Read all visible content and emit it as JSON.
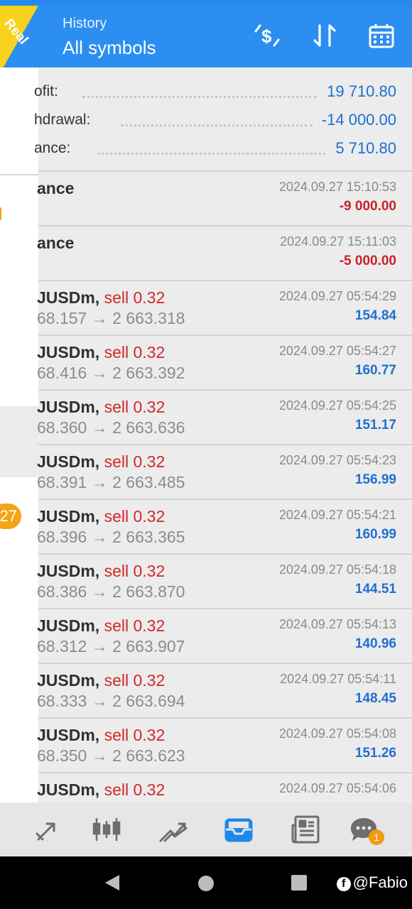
{
  "header": {
    "subtitle": "History",
    "title": "All symbols",
    "account_badge": "Real",
    "accent_color": "#2b8ef0"
  },
  "drawer": {
    "badge": "27"
  },
  "summary": {
    "rows": [
      {
        "label": "ofit:",
        "value": "19 710.80"
      },
      {
        "label": "hdrawal:",
        "value": "-14 000.00"
      },
      {
        "label": "ance:",
        "value": "5 710.80"
      }
    ]
  },
  "history": [
    {
      "title": "ance",
      "time": "2024.09.27 15:10:53",
      "value": "-9 000.00",
      "sign": "neg"
    },
    {
      "title": "ance",
      "time": "2024.09.27 15:11:03",
      "value": "-5 000.00",
      "sign": "neg"
    },
    {
      "symbol": "JUSDm,",
      "side": "sell 0.32",
      "prices": "68.157 → 2 663.318",
      "time": "2024.09.27 05:54:29",
      "value": "154.84",
      "sign": "pos"
    },
    {
      "symbol": "JUSDm,",
      "side": "sell 0.32",
      "prices": "68.416 → 2 663.392",
      "time": "2024.09.27 05:54:27",
      "value": "160.77",
      "sign": "pos"
    },
    {
      "symbol": "JUSDm,",
      "side": "sell 0.32",
      "prices": "68.360 → 2 663.636",
      "time": "2024.09.27 05:54:25",
      "value": "151.17",
      "sign": "pos"
    },
    {
      "symbol": "JUSDm,",
      "side": "sell 0.32",
      "prices": "68.391 → 2 663.485",
      "time": "2024.09.27 05:54:23",
      "value": "156.99",
      "sign": "pos"
    },
    {
      "symbol": "JUSDm,",
      "side": "sell 0.32",
      "prices": "68.396 → 2 663.365",
      "time": "2024.09.27 05:54:21",
      "value": "160.99",
      "sign": "pos"
    },
    {
      "symbol": "JUSDm,",
      "side": "sell 0.32",
      "prices": "68.386 → 2 663.870",
      "time": "2024.09.27 05:54:18",
      "value": "144.51",
      "sign": "pos"
    },
    {
      "symbol": "JUSDm,",
      "side": "sell 0.32",
      "prices": "68.312 → 2 663.907",
      "time": "2024.09.27 05:54:13",
      "value": "140.96",
      "sign": "pos"
    },
    {
      "symbol": "JUSDm,",
      "side": "sell 0.32",
      "prices": "68.333 → 2 663.694",
      "time": "2024.09.27 05:54:11",
      "value": "148.45",
      "sign": "pos"
    },
    {
      "symbol": "JUSDm,",
      "side": "sell 0.32",
      "prices": "68.350 → 2 663.623",
      "time": "2024.09.27 05:54:08",
      "value": "151.26",
      "sign": "pos"
    },
    {
      "symbol": "JUSDm,",
      "side": "sell 0.32",
      "prices": "",
      "time": "2024.09.27 05:54:06",
      "value": "",
      "sign": "pos"
    }
  ],
  "toolbar_icons": [
    "currency-exchange-icon",
    "sort-icon",
    "calendar-icon"
  ],
  "tabs": [
    {
      "icon": "quotes-icon",
      "active": false
    },
    {
      "icon": "chart-icon",
      "active": false
    },
    {
      "icon": "trade-icon",
      "active": false
    },
    {
      "icon": "history-icon",
      "active": true
    },
    {
      "icon": "news-icon",
      "active": false
    },
    {
      "icon": "chat-icon",
      "active": false,
      "badge": "1"
    }
  ],
  "watermark": "@Fabio",
  "colors": {
    "negative": "#c8232a",
    "positive": "#1f70cf",
    "sell": "#d0282c",
    "active_tab": "#1f88ea"
  }
}
